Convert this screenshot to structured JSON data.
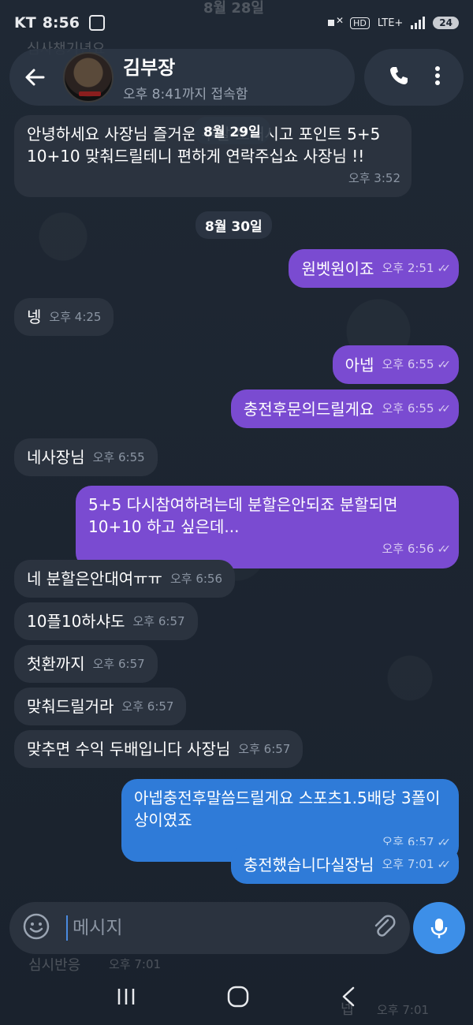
{
  "status_bar": {
    "carrier": "KT",
    "time": "8:56",
    "network": "LTE+",
    "hd": "HD",
    "battery": "24"
  },
  "ghost": {
    "top_date": "8월 28일",
    "top_text": "심사챙기년요",
    "bottom_text": "심시반응",
    "bottom_time": "오후 7:01",
    "bottom_right_text": "넵",
    "bottom_right_time": "오후 7:01"
  },
  "header": {
    "name": "김부장",
    "status": "오후 8:41까지 접속함"
  },
  "messages": [
    {
      "dir": "in",
      "text": "안녕하세요 사장님 즐거운 주말 보내시고 포인트 5+5 10+10 맞춰드릴테니 편하게 연락주십쇼 사장님 !!",
      "time": "오후 3:52"
    },
    {
      "dir": "out",
      "text": "원벳원이죠",
      "time": "오후 2:51"
    },
    {
      "dir": "in",
      "text": "넹",
      "time": "오후 4:25"
    },
    {
      "dir": "out",
      "text": "아넵",
      "time": "오후 6:55"
    },
    {
      "dir": "out",
      "text": "충전후문의드릴게요",
      "time": "오후 6:55"
    },
    {
      "dir": "in",
      "text": "네사장님",
      "time": "오후 6:55"
    },
    {
      "dir": "out",
      "text": "5+5 다시참여하려는데 분할은안되죠 분할되면 10+10 하고 싶은데...",
      "time": "오후 6:56"
    },
    {
      "dir": "in",
      "text": "네 분할은안대여ㅠㅠ",
      "time": "오후 6:56"
    },
    {
      "dir": "in",
      "text": "10플10하샤도",
      "time": "오후 6:57"
    },
    {
      "dir": "in",
      "text": "첫환까지",
      "time": "오후 6:57"
    },
    {
      "dir": "in",
      "text": "맞춰드릴거라",
      "time": "오후 6:57"
    },
    {
      "dir": "in",
      "text": "맞추면 수익 두배입니다 사장님",
      "time": "오후 6:57"
    },
    {
      "dir": "out",
      "text": "아넵충전후말씀드릴게요 스포츠1.5배당 3폴이상이였죠",
      "time": "오후 6:57"
    },
    {
      "dir": "out",
      "text": "충전했습니다실장님",
      "time": "오후 7:01"
    }
  ],
  "dates": {
    "d29": "8월 29일",
    "d30": "8월 30일"
  },
  "input": {
    "placeholder": "메시지"
  },
  "colors": {
    "purple_bubble": "#7a4bd1",
    "blue_bubble": "#2f7bd8",
    "incoming_bubble": "#2b333f",
    "mic_button": "#3d8fe8"
  }
}
